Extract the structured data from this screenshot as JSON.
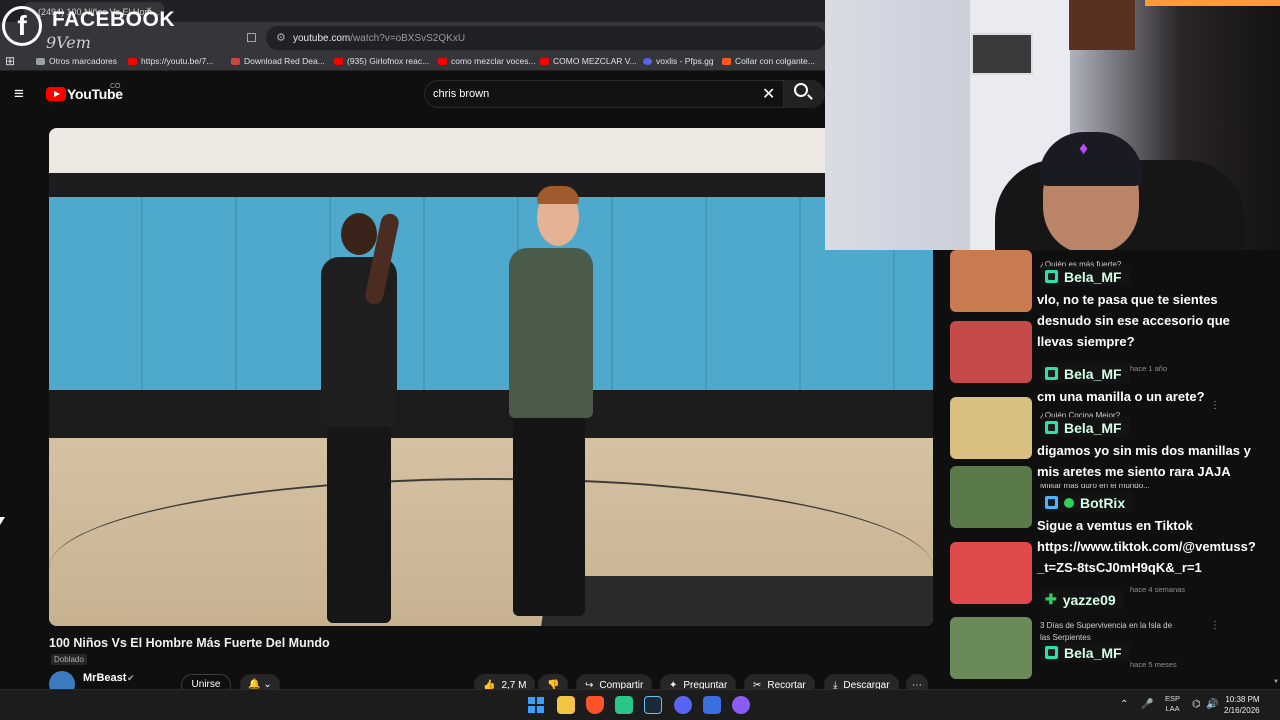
{
  "browser": {
    "tab_title": "(2494) 100 Niños Vs El Hom...",
    "tab_close": "×",
    "url_domain": "youtube.com",
    "url_path": "/watch?v=oBXSvS2QKxU",
    "bookmarks": [
      {
        "label": "Otros marcadores",
        "color": "#9aa0a6"
      },
      {
        "label": "https://youtu.be/7...",
        "color": "#ff0000"
      },
      {
        "label": "Download Red Dea...",
        "color": "#c44"
      },
      {
        "label": "(935) Girlofnox reac...",
        "color": "#ff0000"
      },
      {
        "label": "como mezclar voces...",
        "color": "#ff0000"
      },
      {
        "label": "COMO MEZCLAR V...",
        "color": "#ff0000"
      },
      {
        "label": "voxlis - Pfps.gg",
        "color": "#5865f2"
      },
      {
        "label": "Collar con colgante...",
        "color": "#ff5a1f"
      }
    ]
  },
  "overlay": {
    "facebook_logo": "f",
    "facebook_text": "FACEBOOK",
    "handle": "9Vem"
  },
  "youtube": {
    "brand": "YouTube",
    "country": "CO",
    "search_value": "chris brown",
    "clear_glyph": "✕",
    "menu_glyph": "≡"
  },
  "video": {
    "title": "100 Niños Vs El Hombre Más Fuerte Del Mundo",
    "dub_badge": "Doblado",
    "channel": "MrBeast",
    "verified": "✔",
    "join_label": "Unirse",
    "bell_label": "🔔 ⌄",
    "actions": [
      {
        "icon": "👍",
        "label": "2,7 M"
      },
      {
        "icon": "👎",
        "label": ""
      },
      {
        "icon": "↪",
        "label": "Compartir"
      },
      {
        "icon": "✦",
        "label": "Preguntar"
      },
      {
        "icon": "✂",
        "label": "Recortar"
      },
      {
        "icon": "⤓",
        "label": "Descargar"
      },
      {
        "icon": "⋯",
        "label": ""
      }
    ]
  },
  "recommended": [
    {
      "title": "¿Quién es más fuerte?",
      "meta": "hace 1 año",
      "color": "#c87a50"
    },
    {
      "title": "",
      "meta": "hace 1 año",
      "color": "#c74a4a"
    },
    {
      "title": "¿Quién Cocina Mejor?",
      "meta": "",
      "color": "#d9c080"
    },
    {
      "title": "Militar más duro en el mundo...",
      "meta": "",
      "color": "#5a7a4a"
    },
    {
      "title": "",
      "meta": "hace 4 semanas",
      "color": "#e04a4a"
    },
    {
      "title": "3 Días de Supervivencia en la Isla de las Serpientes",
      "meta": "hace 5 meses",
      "color": "#6a8a5a"
    }
  ],
  "chat": [
    {
      "user": "Bela_MF",
      "badge": "sub",
      "message_lines": [
        "vlo, no te pasa que te sientes",
        "desnudo sin ese accesorio que",
        "llevas siempre?"
      ]
    },
    {
      "user": "Bela_MF",
      "badge": "sub",
      "message_lines": [
        "cm una manilla o un arete?"
      ]
    },
    {
      "user": "Bela_MF",
      "badge": "sub",
      "message_lines": [
        "digamos yo sin mis dos manillas y",
        "mis aretes me siento rara JAJA"
      ]
    },
    {
      "user": "BotRix",
      "badge": "bot",
      "message_lines": [
        "Sigue a vemtus en Tiktok",
        "https://www.tiktok.com/@vemtuss?",
        "_t=ZS-8tsCJ0mH9qK&_r=1"
      ]
    },
    {
      "user": "yazze09",
      "badge": "plus",
      "message_lines": []
    },
    {
      "user": "Bela_MF",
      "badge": "sub",
      "message_lines": []
    }
  ],
  "taskbar": {
    "lang_top": "ESP",
    "lang_bottom": "LAA",
    "time": "10:38 PM",
    "date": "2/16/2026",
    "tray_up": "⌃",
    "mic": "🎤",
    "wifi": "⌬",
    "volume": "🔊",
    "apps": [
      {
        "name": "file-explorer",
        "color": "#f4c542"
      },
      {
        "name": "brave",
        "color": "#fb542b"
      },
      {
        "name": "app-green",
        "color": "#29c58a"
      },
      {
        "name": "steam",
        "color": "#1b2838"
      },
      {
        "name": "discord",
        "color": "#5865f2"
      },
      {
        "name": "app-blue",
        "color": "#3b6fe0"
      },
      {
        "name": "app-purple",
        "color": "#8a5cf6"
      }
    ]
  }
}
